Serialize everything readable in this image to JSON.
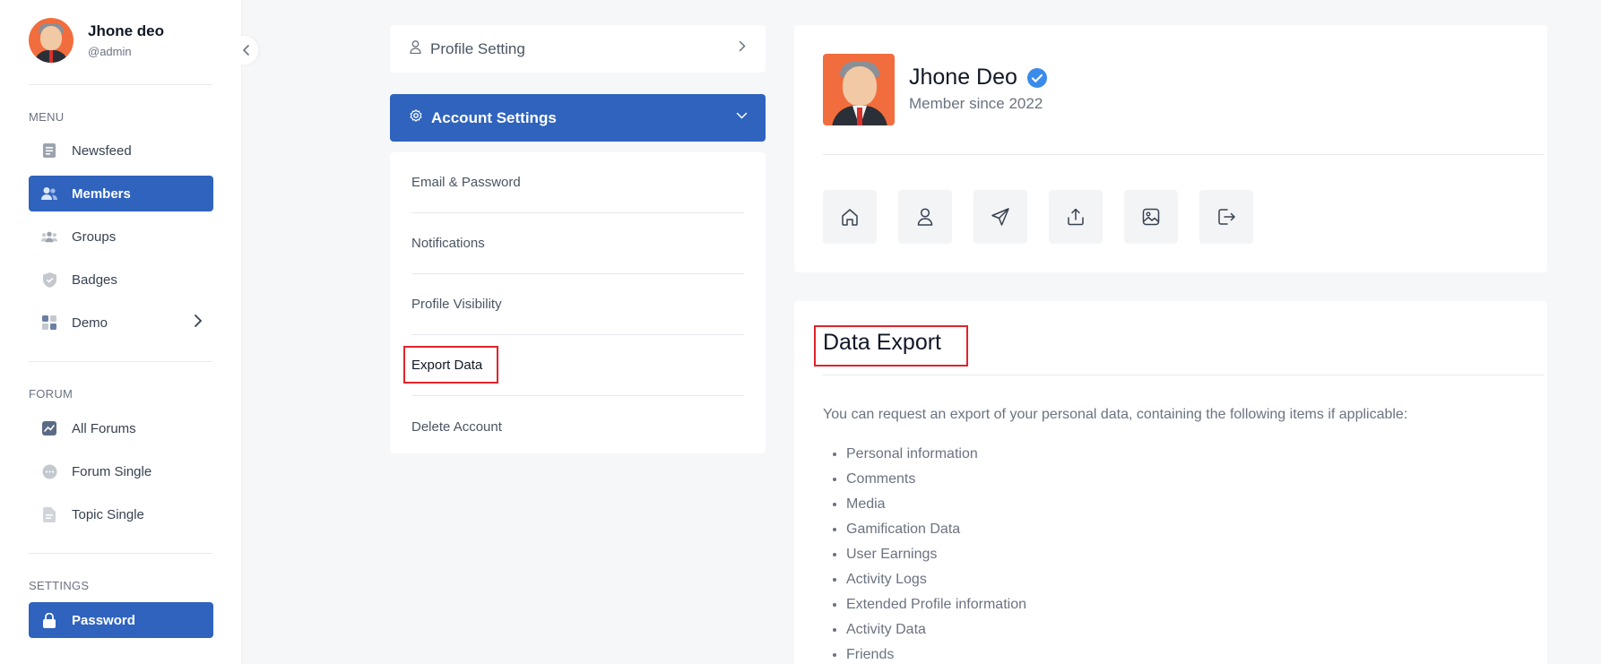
{
  "user": {
    "name": "Jhone deo",
    "handle": "@admin"
  },
  "sidebar": {
    "menu_title": "MENU",
    "menu_items": [
      {
        "label": "Newsfeed",
        "icon": "newsfeed-icon"
      },
      {
        "label": "Members",
        "icon": "members-icon",
        "active": true
      },
      {
        "label": "Groups",
        "icon": "groups-icon"
      },
      {
        "label": "Badges",
        "icon": "badge-icon"
      },
      {
        "label": "Demo",
        "icon": "grid-icon",
        "has_submenu": true
      }
    ],
    "forum_title": "FORUM",
    "forum_items": [
      {
        "label": "All Forums",
        "icon": "chart-icon"
      },
      {
        "label": "Forum Single",
        "icon": "chat-bubble-icon"
      },
      {
        "label": "Topic Single",
        "icon": "document-icon"
      }
    ],
    "settings_title": "SETTINGS",
    "settings_items": [
      {
        "label": "Password",
        "icon": "lock-icon",
        "active": true
      }
    ]
  },
  "settings_panel": {
    "profile_setting": "Profile Setting",
    "account_settings": "Account Settings",
    "items": [
      "Email & Password",
      "Notifications",
      "Profile Visibility",
      "Export Data",
      "Delete Account"
    ],
    "selected": "Export Data"
  },
  "profile": {
    "name": "Jhone Deo",
    "member_since": "Member since 2022",
    "verified": true,
    "actions": [
      "home-icon",
      "user-icon",
      "send-icon",
      "share-icon",
      "image-icon",
      "logout-icon"
    ]
  },
  "export": {
    "title": "Data Export",
    "description": "You can request an export of your personal data, containing the following items if applicable:",
    "items": [
      "Personal information",
      "Comments",
      "Media",
      "Gamification Data",
      "User Earnings",
      "Activity Logs",
      "Extended Profile information",
      "Activity Data",
      "Friends"
    ]
  },
  "colors": {
    "primary": "#2f63bd",
    "highlight": "#e0242a",
    "background": "#f6f7f9"
  }
}
